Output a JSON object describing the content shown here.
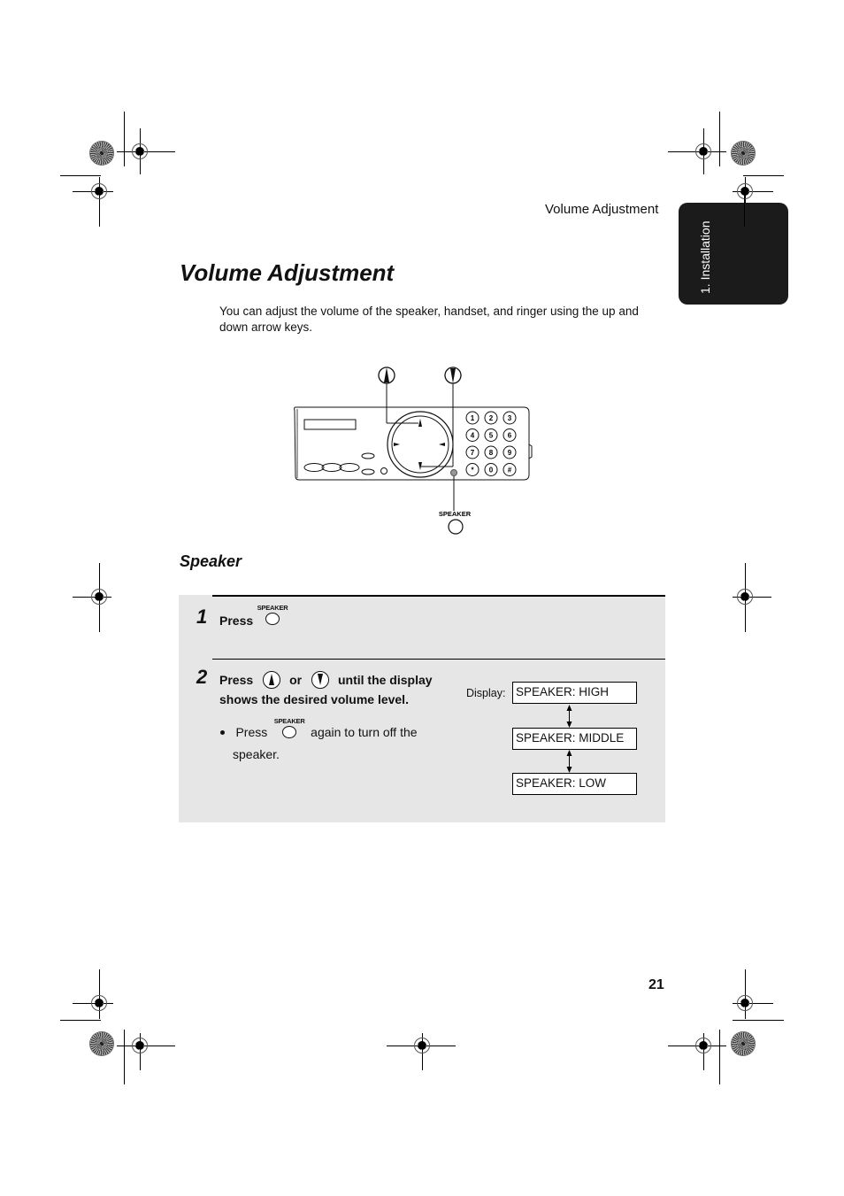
{
  "header": {
    "running_head": "Volume Adjustment",
    "chapter_tab": "1. Installation"
  },
  "title": "Volume Adjustment",
  "intro": "You can adjust the volume of the speaker, handset, and ringer using the up and down arrow keys.",
  "diagram": {
    "callout_up": "up-arrow-key",
    "callout_down": "down-arrow-key",
    "speaker_label": "SPEAKER",
    "keypad": [
      "1",
      "2",
      "3",
      "4",
      "5",
      "6",
      "7",
      "8",
      "9",
      "*",
      "0",
      "#"
    ]
  },
  "section_heading": "Speaker",
  "steps": [
    {
      "number": "1",
      "press": "Press",
      "key_label": "SPEAKER"
    },
    {
      "number": "2",
      "press": "Press",
      "or": "or",
      "text_line1": "until the display",
      "text_line2": "shows the desired volume level.",
      "bullet_press": "Press",
      "bullet_key_label": "SPEAKER",
      "bullet_text_1": "again to turn off the",
      "bullet_text_2": "speaker."
    }
  ],
  "display": {
    "label": "Display:",
    "levels": [
      "SPEAKER: HIGH",
      "SPEAKER: MIDDLE",
      "SPEAKER: LOW"
    ]
  },
  "page_number": "21"
}
